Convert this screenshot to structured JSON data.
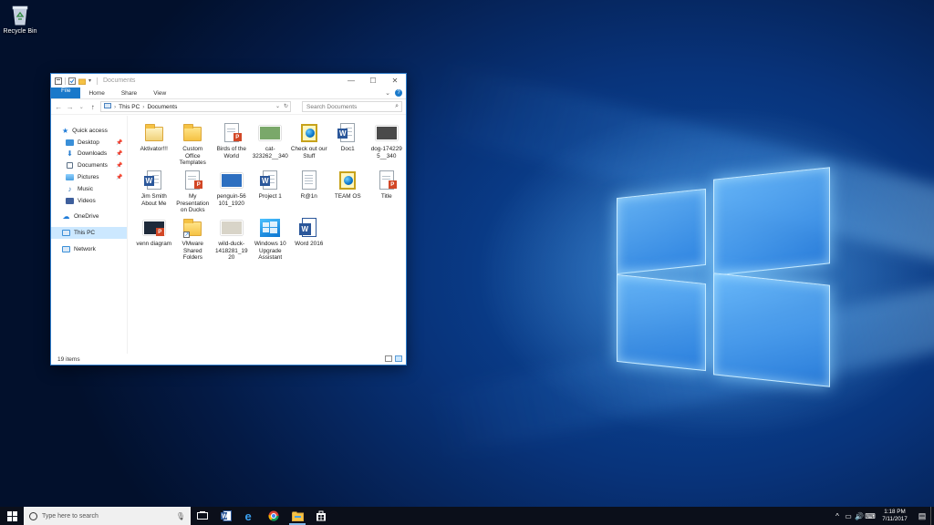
{
  "desktop": {
    "icons": [
      {
        "label": "Recycle Bin",
        "icon": "recycle-bin-icon"
      }
    ]
  },
  "explorer": {
    "title": "Documents",
    "ribbon_tabs": [
      "File",
      "Home",
      "Share",
      "View"
    ],
    "address": {
      "segments": [
        "This PC",
        "Documents"
      ]
    },
    "search_placeholder": "Search Documents",
    "status": "19 items",
    "sidebar": [
      {
        "label": "Quick access",
        "icon": "star-icon",
        "color": "#1e7bd8",
        "pinned": false,
        "indent": false
      },
      {
        "label": "Desktop",
        "icon": "desktop-icon",
        "color": "#3a8fd8",
        "pinned": true,
        "indent": true
      },
      {
        "label": "Downloads",
        "icon": "download-icon",
        "color": "#2b7fd0",
        "pinned": true,
        "indent": true
      },
      {
        "label": "Documents",
        "icon": "document-icon",
        "color": "#5a6f86",
        "pinned": true,
        "indent": true
      },
      {
        "label": "Pictures",
        "icon": "pictures-icon",
        "color": "#4aa0e0",
        "pinned": true,
        "indent": true
      },
      {
        "label": "Music",
        "icon": "music-icon",
        "color": "#2a6fb8",
        "pinned": false,
        "indent": true
      },
      {
        "label": "Videos",
        "icon": "videos-icon",
        "color": "#3e5f9c",
        "pinned": false,
        "indent": true
      },
      {
        "label": "OneDrive",
        "icon": "cloud-icon",
        "color": "#1e7bd8",
        "pinned": false,
        "indent": false
      },
      {
        "label": "This PC",
        "icon": "computer-icon",
        "color": "#3a8fd8",
        "pinned": false,
        "indent": false,
        "selected": true
      },
      {
        "label": "Network",
        "icon": "network-icon",
        "color": "#3a8fd8",
        "pinned": false,
        "indent": false
      }
    ],
    "files": [
      {
        "name": "Aktivator!!!",
        "type": "folder-plain"
      },
      {
        "name": "Custom Office Templates",
        "type": "folder"
      },
      {
        "name": "Birds of the World",
        "type": "pptx"
      },
      {
        "name": "cat-323262__340",
        "type": "photo",
        "color": "#7aa86a"
      },
      {
        "name": "Check out our Stuff",
        "type": "globe"
      },
      {
        "name": "Doc1",
        "type": "docx"
      },
      {
        "name": "dog-174229 5__340",
        "type": "photo",
        "color": "#4a4a4a"
      },
      {
        "name": "Jim Smith About Me",
        "type": "docx"
      },
      {
        "name": "My Presentation on Ducks",
        "type": "pptx"
      },
      {
        "name": "penguin-56 101_1920",
        "type": "photo",
        "color": "#2d6fc0"
      },
      {
        "name": "Project 1",
        "type": "docx"
      },
      {
        "name": "R@1n",
        "type": "text"
      },
      {
        "name": "TEAM OS",
        "type": "globe"
      },
      {
        "name": "Title",
        "type": "pptx"
      },
      {
        "name": "venn diagram",
        "type": "pptx-dark"
      },
      {
        "name": "VMware Shared Folders",
        "type": "folder-shortcut"
      },
      {
        "name": "wild-duck-1418281_19 20",
        "type": "photo",
        "color": "#d8d4c8"
      },
      {
        "name": "Windows 10 Upgrade Assistant",
        "type": "win10"
      },
      {
        "name": "Word 2016",
        "type": "word-app"
      }
    ]
  },
  "taskbar": {
    "search_placeholder": "Type here to search",
    "apps": [
      {
        "name": "task-view-icon",
        "active": false
      },
      {
        "name": "word-icon",
        "active": false
      },
      {
        "name": "edge-icon",
        "active": false
      },
      {
        "name": "chrome-icon",
        "active": false
      },
      {
        "name": "file-explorer-icon",
        "active": true
      },
      {
        "name": "store-icon",
        "active": false
      }
    ],
    "time": "1:18 PM",
    "date": "7/11/2017"
  }
}
